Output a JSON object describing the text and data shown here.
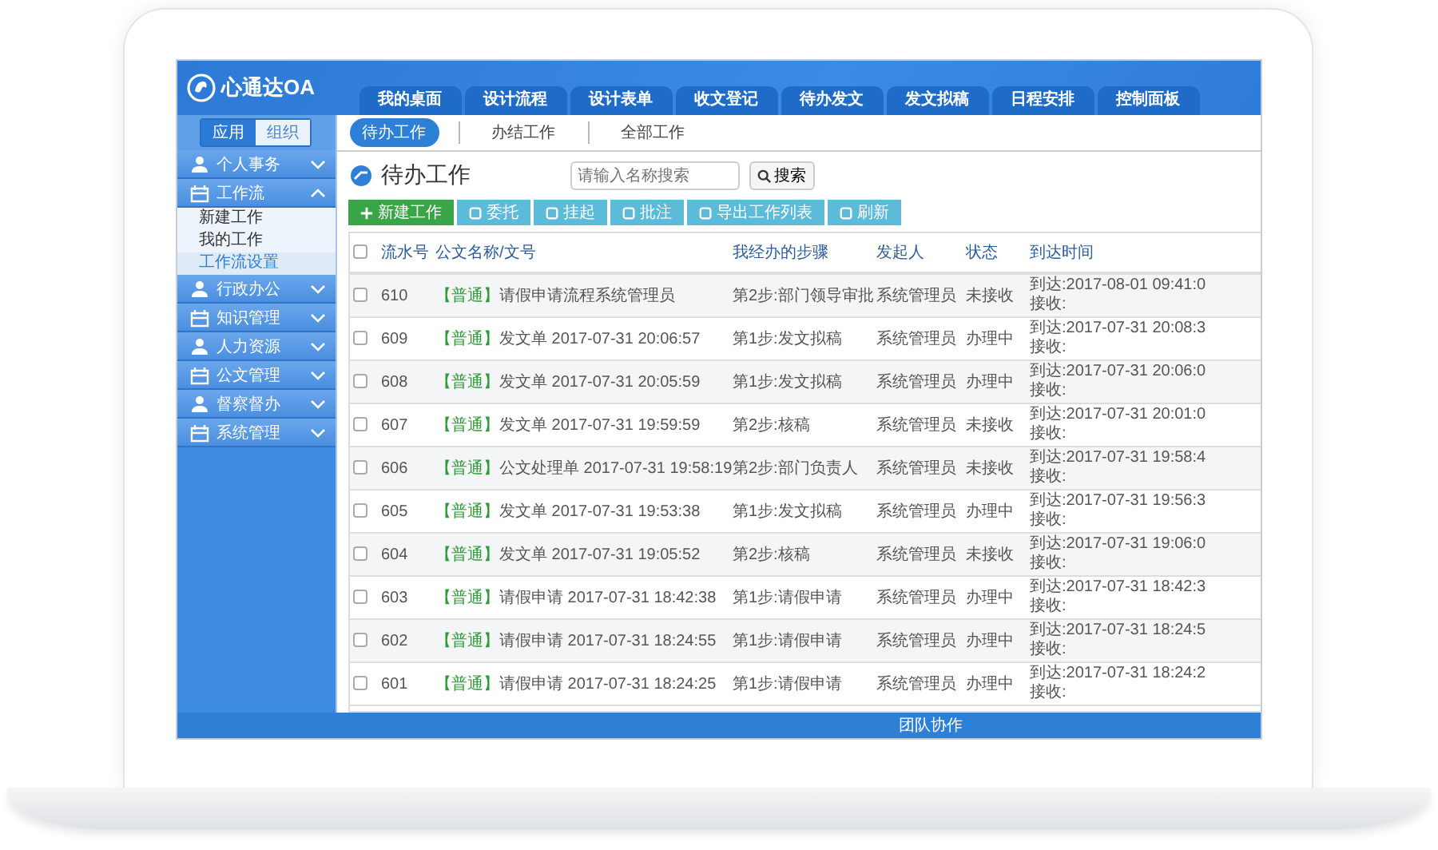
{
  "logo": {
    "text": "心通达OA"
  },
  "nav_tabs": [
    "我的桌面",
    "设计流程",
    "设计表单",
    "收文登记",
    "待办发文",
    "发文拟稿",
    "日程安排",
    "控制面板"
  ],
  "sidebar": {
    "switch": [
      {
        "label": "应用",
        "selected": true
      },
      {
        "label": "组织",
        "selected": false
      }
    ],
    "items": [
      {
        "label": "个人事务",
        "expanded": false
      },
      {
        "label": "工作流",
        "expanded": true,
        "children": [
          {
            "label": "新建工作",
            "selected": false
          },
          {
            "label": "我的工作",
            "selected": false
          },
          {
            "label": "工作流设置",
            "selected": true
          }
        ]
      },
      {
        "label": "行政办公",
        "expanded": false
      },
      {
        "label": "知识管理",
        "expanded": false
      },
      {
        "label": "人力资源",
        "expanded": false
      },
      {
        "label": "公文管理",
        "expanded": false
      },
      {
        "label": "督察督办",
        "expanded": false
      },
      {
        "label": "系统管理",
        "expanded": false
      }
    ]
  },
  "sub_tabs": [
    {
      "label": "待办工作",
      "selected": true
    },
    {
      "label": "办结工作",
      "selected": false
    },
    {
      "label": "全部工作",
      "selected": false
    }
  ],
  "page_title": "待办工作",
  "search": {
    "placeholder": "请输入名称搜索",
    "button": "搜索"
  },
  "toolbar": [
    {
      "label": "新建工作",
      "kind": "primary"
    },
    {
      "label": "委托",
      "kind": "normal"
    },
    {
      "label": "挂起",
      "kind": "normal"
    },
    {
      "label": "批注",
      "kind": "normal"
    },
    {
      "label": "导出工作列表",
      "kind": "normal"
    },
    {
      "label": "刷新",
      "kind": "normal"
    }
  ],
  "table": {
    "header_checked": false,
    "columns": [
      "流水号",
      "公文名称/文号",
      "我经办的步骤",
      "发起人",
      "状态",
      "到达时间"
    ],
    "rows": [
      {
        "checked": false,
        "no": "610",
        "tag": "【普通】",
        "title": "请假申请流程系统管理员",
        "step": "第2步:部门领导审批",
        "sender": "系统管理员",
        "status": "未接收",
        "arrive": "到达:2017-08-01 09:41:0",
        "receive": "接收:"
      },
      {
        "checked": false,
        "no": "609",
        "tag": "【普通】",
        "title": "发文单 2017-07-31 20:06:57",
        "step": "第1步:发文拟稿",
        "sender": "系统管理员",
        "status": "办理中",
        "arrive": "到达:2017-07-31 20:08:3",
        "receive": "接收:"
      },
      {
        "checked": false,
        "no": "608",
        "tag": "【普通】",
        "title": "发文单 2017-07-31 20:05:59",
        "step": "第1步:发文拟稿",
        "sender": "系统管理员",
        "status": "办理中",
        "arrive": "到达:2017-07-31 20:06:0",
        "receive": "接收:"
      },
      {
        "checked": false,
        "no": "607",
        "tag": "【普通】",
        "title": "发文单 2017-07-31 19:59:59",
        "step": "第2步:核稿",
        "sender": "系统管理员",
        "status": "未接收",
        "arrive": "到达:2017-07-31 20:01:0",
        "receive": "接收:"
      },
      {
        "checked": false,
        "no": "606",
        "tag": "【普通】",
        "title": "公文处理单 2017-07-31 19:58:19",
        "step": "第2步:部门负责人",
        "sender": "系统管理员",
        "status": "未接收",
        "arrive": "到达:2017-07-31 19:58:4",
        "receive": "接收:"
      },
      {
        "checked": false,
        "no": "605",
        "tag": "【普通】",
        "title": "发文单 2017-07-31 19:53:38",
        "step": "第1步:发文拟稿",
        "sender": "系统管理员",
        "status": "办理中",
        "arrive": "到达:2017-07-31 19:56:3",
        "receive": "接收:"
      },
      {
        "checked": false,
        "no": "604",
        "tag": "【普通】",
        "title": "发文单 2017-07-31 19:05:52",
        "step": "第2步:核稿",
        "sender": "系统管理员",
        "status": "未接收",
        "arrive": "到达:2017-07-31 19:06:0",
        "receive": "接收:"
      },
      {
        "checked": false,
        "no": "603",
        "tag": "【普通】",
        "title": "请假申请 2017-07-31 18:42:38",
        "step": "第1步:请假申请",
        "sender": "系统管理员",
        "status": "办理中",
        "arrive": "到达:2017-07-31 18:42:3",
        "receive": "接收:"
      },
      {
        "checked": false,
        "no": "602",
        "tag": "【普通】",
        "title": "请假申请 2017-07-31 18:24:55",
        "step": "第1步:请假申请",
        "sender": "系统管理员",
        "status": "办理中",
        "arrive": "到达:2017-07-31 18:24:5",
        "receive": "接收:"
      },
      {
        "checked": false,
        "no": "601",
        "tag": "【普通】",
        "title": "请假申请 2017-07-31 18:24:25",
        "step": "第1步:请假申请",
        "sender": "系统管理员",
        "status": "办理中",
        "arrive": "到达:2017-07-31 18:24:2",
        "receive": "接收:"
      }
    ]
  },
  "footer": "团队协作"
}
